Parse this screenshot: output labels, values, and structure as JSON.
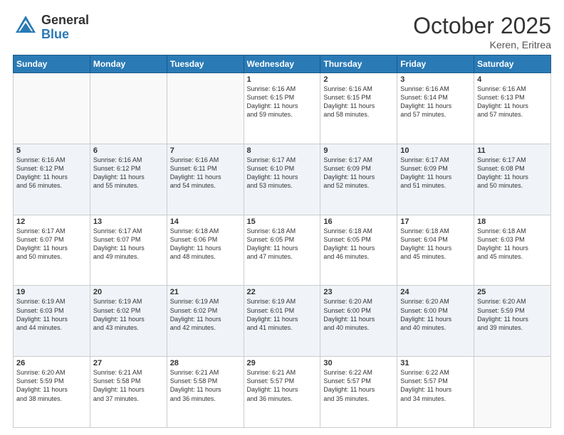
{
  "header": {
    "logo_general": "General",
    "logo_blue": "Blue",
    "month_title": "October 2025",
    "location": "Keren, Eritrea"
  },
  "days_of_week": [
    "Sunday",
    "Monday",
    "Tuesday",
    "Wednesday",
    "Thursday",
    "Friday",
    "Saturday"
  ],
  "weeks": [
    [
      {
        "num": "",
        "info": ""
      },
      {
        "num": "",
        "info": ""
      },
      {
        "num": "",
        "info": ""
      },
      {
        "num": "1",
        "info": "Sunrise: 6:16 AM\nSunset: 6:15 PM\nDaylight: 11 hours\nand 59 minutes."
      },
      {
        "num": "2",
        "info": "Sunrise: 6:16 AM\nSunset: 6:15 PM\nDaylight: 11 hours\nand 58 minutes."
      },
      {
        "num": "3",
        "info": "Sunrise: 6:16 AM\nSunset: 6:14 PM\nDaylight: 11 hours\nand 57 minutes."
      },
      {
        "num": "4",
        "info": "Sunrise: 6:16 AM\nSunset: 6:13 PM\nDaylight: 11 hours\nand 57 minutes."
      }
    ],
    [
      {
        "num": "5",
        "info": "Sunrise: 6:16 AM\nSunset: 6:12 PM\nDaylight: 11 hours\nand 56 minutes."
      },
      {
        "num": "6",
        "info": "Sunrise: 6:16 AM\nSunset: 6:12 PM\nDaylight: 11 hours\nand 55 minutes."
      },
      {
        "num": "7",
        "info": "Sunrise: 6:16 AM\nSunset: 6:11 PM\nDaylight: 11 hours\nand 54 minutes."
      },
      {
        "num": "8",
        "info": "Sunrise: 6:17 AM\nSunset: 6:10 PM\nDaylight: 11 hours\nand 53 minutes."
      },
      {
        "num": "9",
        "info": "Sunrise: 6:17 AM\nSunset: 6:09 PM\nDaylight: 11 hours\nand 52 minutes."
      },
      {
        "num": "10",
        "info": "Sunrise: 6:17 AM\nSunset: 6:09 PM\nDaylight: 11 hours\nand 51 minutes."
      },
      {
        "num": "11",
        "info": "Sunrise: 6:17 AM\nSunset: 6:08 PM\nDaylight: 11 hours\nand 50 minutes."
      }
    ],
    [
      {
        "num": "12",
        "info": "Sunrise: 6:17 AM\nSunset: 6:07 PM\nDaylight: 11 hours\nand 50 minutes."
      },
      {
        "num": "13",
        "info": "Sunrise: 6:17 AM\nSunset: 6:07 PM\nDaylight: 11 hours\nand 49 minutes."
      },
      {
        "num": "14",
        "info": "Sunrise: 6:18 AM\nSunset: 6:06 PM\nDaylight: 11 hours\nand 48 minutes."
      },
      {
        "num": "15",
        "info": "Sunrise: 6:18 AM\nSunset: 6:05 PM\nDaylight: 11 hours\nand 47 minutes."
      },
      {
        "num": "16",
        "info": "Sunrise: 6:18 AM\nSunset: 6:05 PM\nDaylight: 11 hours\nand 46 minutes."
      },
      {
        "num": "17",
        "info": "Sunrise: 6:18 AM\nSunset: 6:04 PM\nDaylight: 11 hours\nand 45 minutes."
      },
      {
        "num": "18",
        "info": "Sunrise: 6:18 AM\nSunset: 6:03 PM\nDaylight: 11 hours\nand 45 minutes."
      }
    ],
    [
      {
        "num": "19",
        "info": "Sunrise: 6:19 AM\nSunset: 6:03 PM\nDaylight: 11 hours\nand 44 minutes."
      },
      {
        "num": "20",
        "info": "Sunrise: 6:19 AM\nSunset: 6:02 PM\nDaylight: 11 hours\nand 43 minutes."
      },
      {
        "num": "21",
        "info": "Sunrise: 6:19 AM\nSunset: 6:02 PM\nDaylight: 11 hours\nand 42 minutes."
      },
      {
        "num": "22",
        "info": "Sunrise: 6:19 AM\nSunset: 6:01 PM\nDaylight: 11 hours\nand 41 minutes."
      },
      {
        "num": "23",
        "info": "Sunrise: 6:20 AM\nSunset: 6:00 PM\nDaylight: 11 hours\nand 40 minutes."
      },
      {
        "num": "24",
        "info": "Sunrise: 6:20 AM\nSunset: 6:00 PM\nDaylight: 11 hours\nand 40 minutes."
      },
      {
        "num": "25",
        "info": "Sunrise: 6:20 AM\nSunset: 5:59 PM\nDaylight: 11 hours\nand 39 minutes."
      }
    ],
    [
      {
        "num": "26",
        "info": "Sunrise: 6:20 AM\nSunset: 5:59 PM\nDaylight: 11 hours\nand 38 minutes."
      },
      {
        "num": "27",
        "info": "Sunrise: 6:21 AM\nSunset: 5:58 PM\nDaylight: 11 hours\nand 37 minutes."
      },
      {
        "num": "28",
        "info": "Sunrise: 6:21 AM\nSunset: 5:58 PM\nDaylight: 11 hours\nand 36 minutes."
      },
      {
        "num": "29",
        "info": "Sunrise: 6:21 AM\nSunset: 5:57 PM\nDaylight: 11 hours\nand 36 minutes."
      },
      {
        "num": "30",
        "info": "Sunrise: 6:22 AM\nSunset: 5:57 PM\nDaylight: 11 hours\nand 35 minutes."
      },
      {
        "num": "31",
        "info": "Sunrise: 6:22 AM\nSunset: 5:57 PM\nDaylight: 11 hours\nand 34 minutes."
      },
      {
        "num": "",
        "info": ""
      }
    ]
  ]
}
